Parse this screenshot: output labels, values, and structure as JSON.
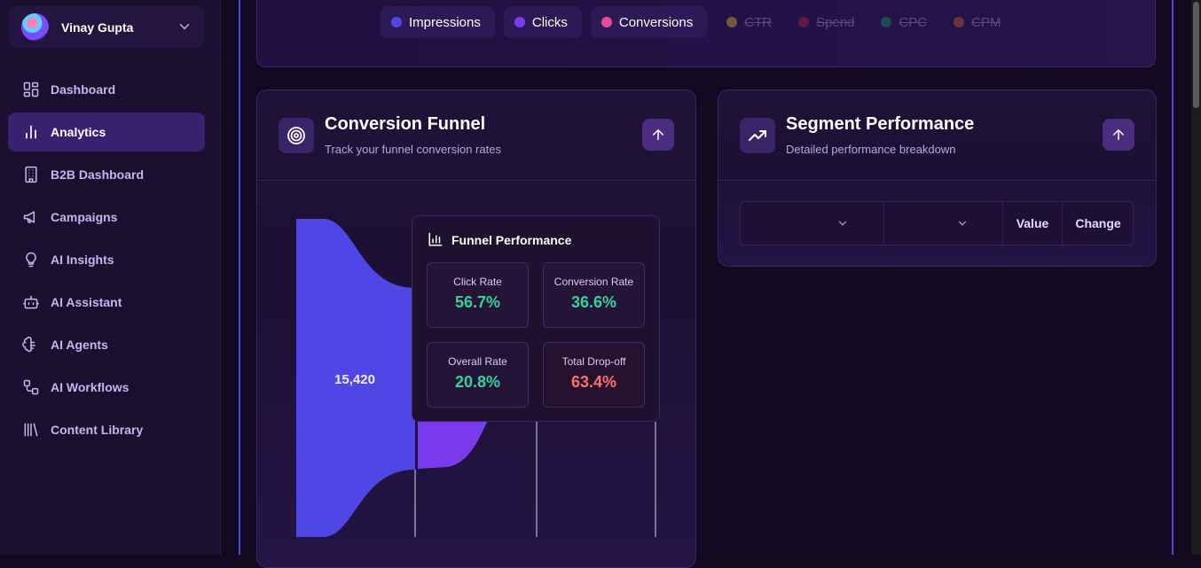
{
  "user": {
    "name": "Vinay Gupta"
  },
  "nav": [
    {
      "label": "Dashboard",
      "icon": "dashboard-icon",
      "active": false
    },
    {
      "label": "Analytics",
      "icon": "bar-chart-icon",
      "active": true
    },
    {
      "label": "B2B Dashboard",
      "icon": "building-icon",
      "active": false
    },
    {
      "label": "Campaigns",
      "icon": "megaphone-icon",
      "active": false
    },
    {
      "label": "AI Insights",
      "icon": "lightbulb-icon",
      "active": false
    },
    {
      "label": "AI Assistant",
      "icon": "bot-icon",
      "active": false
    },
    {
      "label": "AI Agents",
      "icon": "brain-icon",
      "active": false
    },
    {
      "label": "AI Workflows",
      "icon": "workflow-icon",
      "active": false
    },
    {
      "label": "Content Library",
      "icon": "library-icon",
      "active": false
    }
  ],
  "legend": [
    {
      "label": "Impressions",
      "color": "#4f46e5",
      "enabled": true
    },
    {
      "label": "Clicks",
      "color": "#7c3aed",
      "enabled": true
    },
    {
      "label": "Conversions",
      "color": "#ec4899",
      "enabled": true
    },
    {
      "label": "CTR",
      "color": "#a08a3a",
      "enabled": false
    },
    {
      "label": "Spend",
      "color": "#8a1f4a",
      "enabled": false
    },
    {
      "label": "CPC",
      "color": "#1f6b5a",
      "enabled": false
    },
    {
      "label": "CPM",
      "color": "#9a4a2a",
      "enabled": false
    }
  ],
  "funnel_card": {
    "title": "Conversion Funnel",
    "subtitle": "Track your funnel conversion rates",
    "first_value_label": "15,420",
    "colors": {
      "impressions": "#4f46e5",
      "clicks": "#7c3aed"
    }
  },
  "funnel_performance": {
    "title": "Funnel Performance",
    "metrics": [
      {
        "label": "Click Rate",
        "value": "56.7%",
        "tone": "positive"
      },
      {
        "label": "Conversion Rate",
        "value": "36.6%",
        "tone": "positive"
      },
      {
        "label": "Overall Rate",
        "value": "20.8%",
        "tone": "positive"
      },
      {
        "label": "Total Drop-off",
        "value": "63.4%",
        "tone": "negative"
      }
    ]
  },
  "segment_card": {
    "title": "Segment Performance",
    "subtitle": "Detailed performance breakdown",
    "columns": [
      "",
      "",
      "Value",
      "Change"
    ]
  }
}
